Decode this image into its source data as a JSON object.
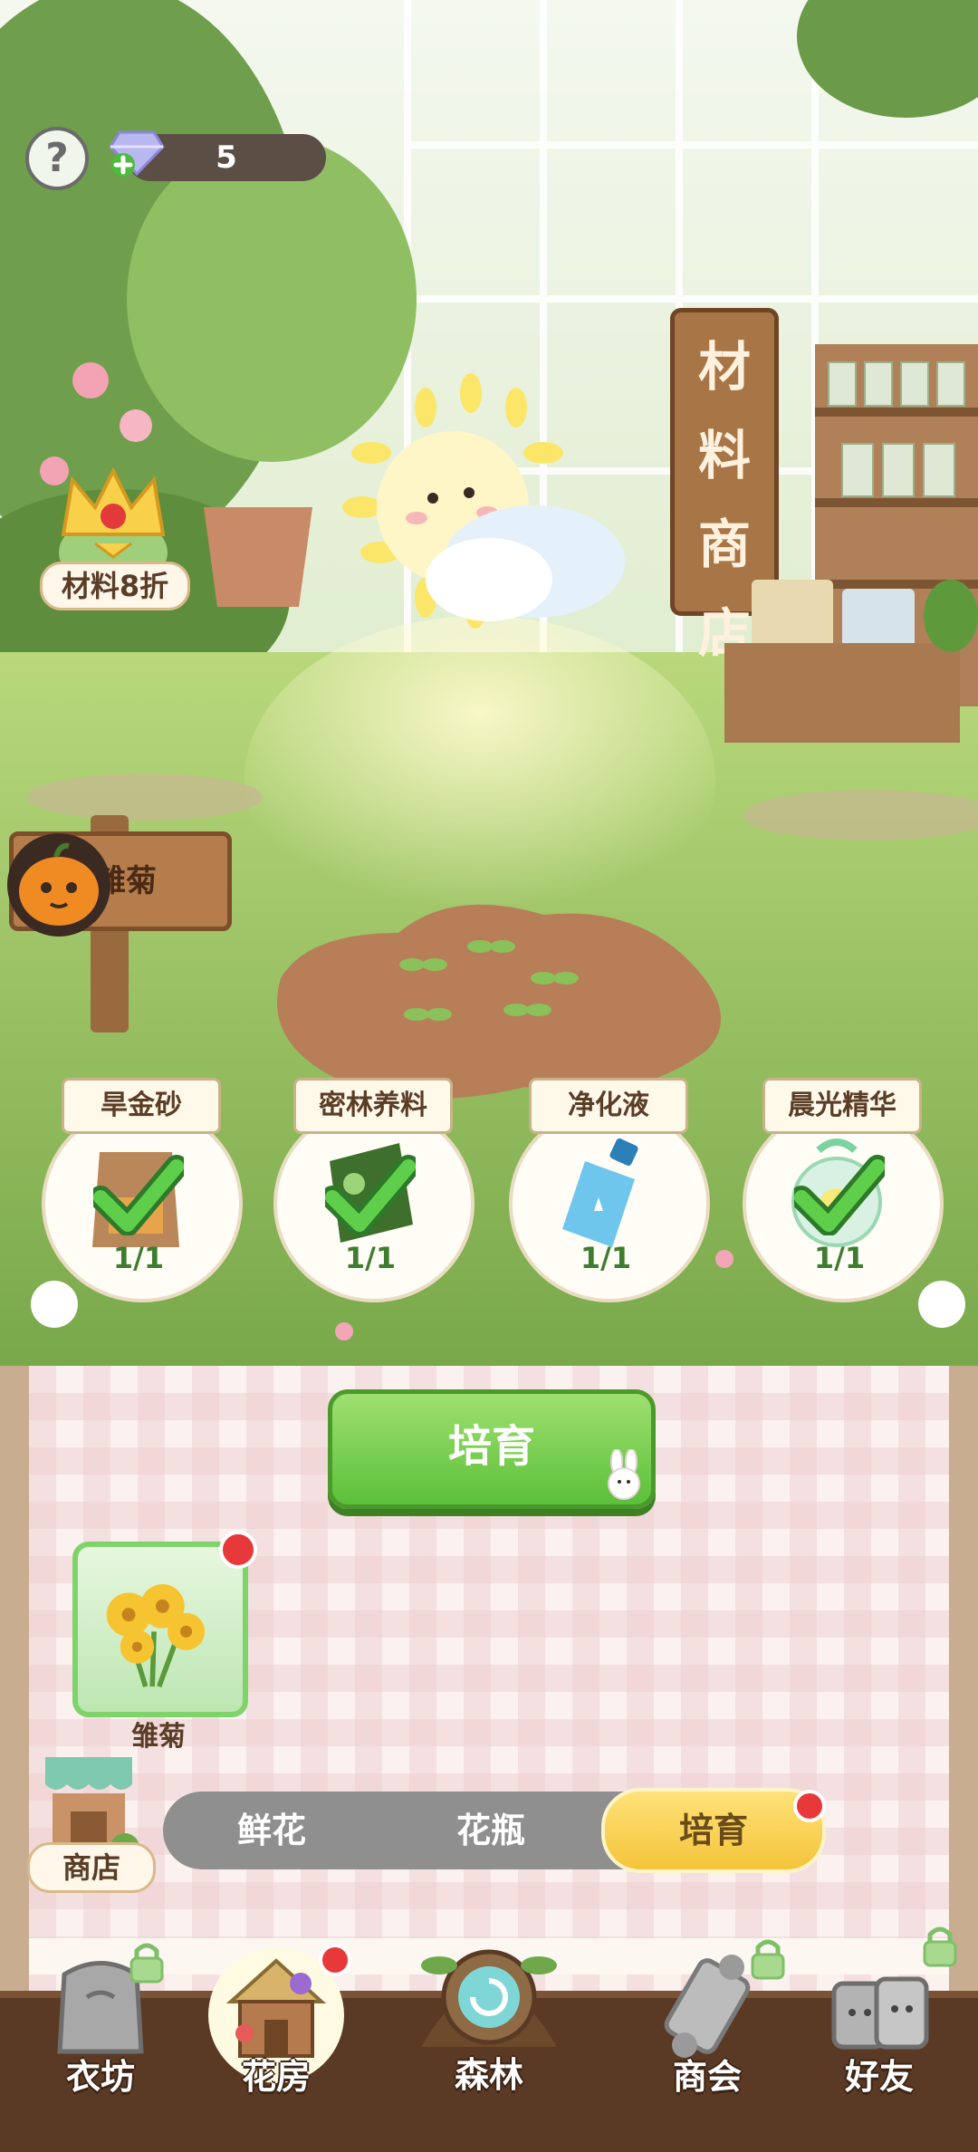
{
  "hud": {
    "gem_count": "5",
    "help_symbol": "?"
  },
  "discount_badge": {
    "label": "材料8折"
  },
  "plant_sign": {
    "label": "雏菊"
  },
  "material_shop_sign": {
    "chars": [
      "材",
      "料",
      "商",
      "店"
    ]
  },
  "materials": [
    {
      "name": "旱金砂",
      "count": "1/1",
      "icon": "sand-bag-icon",
      "complete": true
    },
    {
      "name": "密林养料",
      "count": "1/1",
      "icon": "fertilizer-pack-icon",
      "complete": true
    },
    {
      "name": "净化液",
      "count": "1/1",
      "icon": "water-bottle-icon",
      "complete": true
    },
    {
      "name": "晨光精华",
      "count": "1/1",
      "icon": "light-orb-icon",
      "complete": true
    }
  ],
  "grow_button": {
    "label": "培育"
  },
  "flower_item": {
    "label": "雏菊",
    "icon": "daisy-bouquet-icon"
  },
  "shop_button": {
    "label": "商店"
  },
  "tabs": [
    {
      "label": "鲜花",
      "active": false
    },
    {
      "label": "花瓶",
      "active": false
    },
    {
      "label": "培育",
      "active": true
    }
  ],
  "nav": [
    {
      "label": "衣坊",
      "icon": "armor-icon",
      "locked": true
    },
    {
      "label": "花房",
      "icon": "flower-house-icon",
      "active": true,
      "badge": true
    },
    {
      "label": "森林",
      "icon": "forest-portal-icon"
    },
    {
      "label": "商会",
      "icon": "scroll-icon",
      "locked": true
    },
    {
      "label": "好友",
      "icon": "friends-icon",
      "locked": true
    }
  ],
  "colors": {
    "accent_green": "#5cc03a",
    "active_tab": "#f4c43a",
    "badge_red": "#e8393a"
  }
}
